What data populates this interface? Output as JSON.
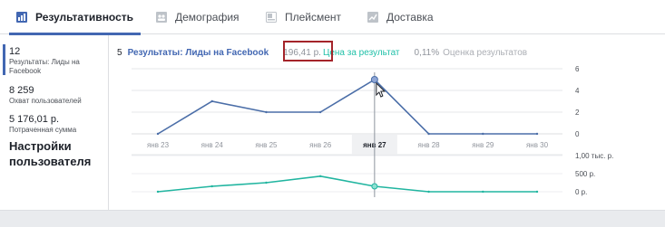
{
  "tabs": [
    {
      "label": "Результативность",
      "active": true,
      "icon": "bar-chart-icon"
    },
    {
      "label": "Демография",
      "active": false,
      "icon": "people-icon"
    },
    {
      "label": "Плейсмент",
      "active": false,
      "icon": "placement-icon"
    },
    {
      "label": "Доставка",
      "active": false,
      "icon": "line-chart-icon"
    }
  ],
  "sidebar": {
    "metrics": [
      {
        "value": "12",
        "label": "Результаты: Лиды на Facebook"
      },
      {
        "value": "8 259",
        "label": "Охват пользователей"
      },
      {
        "value": "5 176,01 р.",
        "label": "Потраченная сумма"
      }
    ],
    "custom_label": "Настройки пользователя"
  },
  "legend": {
    "results_count": "5",
    "results_label": "Результаты: Лиды на Facebook",
    "cost_value": "196,41 р.",
    "cost_label": "Цена за результат",
    "rating_value": "0,11%",
    "rating_label": "Оценка результатов"
  },
  "colors": {
    "accent": "#4267b2",
    "line_blue": "#4b6ea8",
    "line_teal": "#21b5a0",
    "highlight_box": "#a4242a"
  },
  "chart_data": [
    {
      "type": "line",
      "categories": [
        "янв 23",
        "янв 24",
        "янв 25",
        "янв 26",
        "янв 27",
        "янв 28",
        "янв 29",
        "янв 30"
      ],
      "selected_category": "янв 27",
      "series": [
        {
          "values": [
            0,
            3,
            2,
            2,
            5,
            0,
            0,
            0
          ]
        }
      ],
      "ylim": [
        0,
        6
      ],
      "yticks": [
        "0",
        "2",
        "4",
        "6"
      ]
    },
    {
      "type": "line",
      "categories": [
        "янв 23",
        "янв 24",
        "янв 25",
        "янв 26",
        "янв 27",
        "янв 28",
        "янв 29",
        "янв 30"
      ],
      "series": [
        {
          "values": [
            0,
            150,
            250,
            430,
            150,
            0,
            0,
            0
          ]
        }
      ],
      "ylim": [
        0,
        1000
      ],
      "yticks": [
        "0 р.",
        "500 р.",
        "1,00 тыс. р."
      ]
    }
  ]
}
